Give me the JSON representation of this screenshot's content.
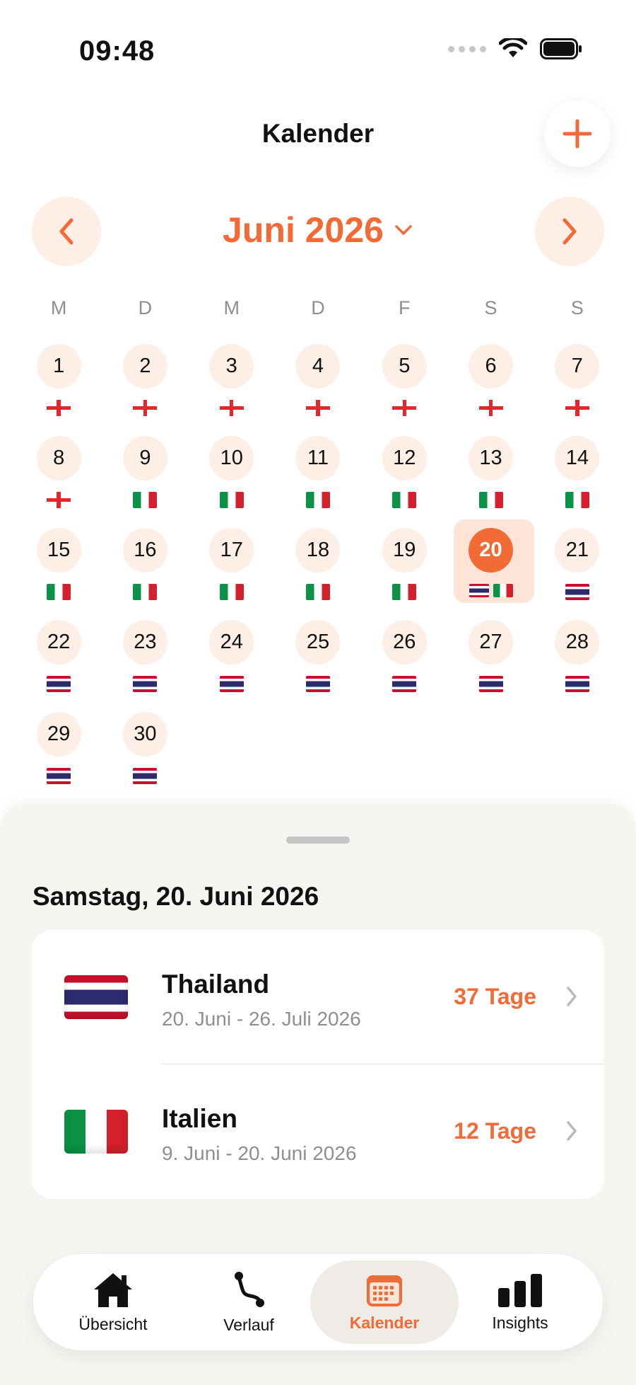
{
  "status_bar": {
    "time": "09:48"
  },
  "header": {
    "title": "Kalender",
    "add_icon": "plus-icon"
  },
  "month_nav": {
    "label": "Juni 2026",
    "prev_icon": "chevron-left-icon",
    "next_icon": "chevron-right-icon",
    "dropdown_icon": "chevron-down-icon"
  },
  "weekdays": [
    "M",
    "D",
    "M",
    "D",
    "F",
    "S",
    "S"
  ],
  "calendar": {
    "selected_day": "20",
    "days": [
      {
        "num": "1",
        "flags": [
          "georgia"
        ]
      },
      {
        "num": "2",
        "flags": [
          "georgia"
        ]
      },
      {
        "num": "3",
        "flags": [
          "georgia"
        ]
      },
      {
        "num": "4",
        "flags": [
          "georgia"
        ]
      },
      {
        "num": "5",
        "flags": [
          "georgia"
        ]
      },
      {
        "num": "6",
        "flags": [
          "georgia"
        ]
      },
      {
        "num": "7",
        "flags": [
          "georgia"
        ]
      },
      {
        "num": "8",
        "flags": [
          "georgia"
        ]
      },
      {
        "num": "9",
        "flags": [
          "italy"
        ]
      },
      {
        "num": "10",
        "flags": [
          "italy"
        ]
      },
      {
        "num": "11",
        "flags": [
          "italy"
        ]
      },
      {
        "num": "12",
        "flags": [
          "italy"
        ]
      },
      {
        "num": "13",
        "flags": [
          "italy"
        ]
      },
      {
        "num": "14",
        "flags": [
          "italy"
        ]
      },
      {
        "num": "15",
        "flags": [
          "italy"
        ]
      },
      {
        "num": "16",
        "flags": [
          "italy"
        ]
      },
      {
        "num": "17",
        "flags": [
          "italy"
        ]
      },
      {
        "num": "18",
        "flags": [
          "italy"
        ]
      },
      {
        "num": "19",
        "flags": [
          "italy"
        ]
      },
      {
        "num": "20",
        "flags": [
          "thailand",
          "italy"
        ]
      },
      {
        "num": "21",
        "flags": [
          "thailand"
        ]
      },
      {
        "num": "22",
        "flags": [
          "thailand"
        ]
      },
      {
        "num": "23",
        "flags": [
          "thailand"
        ]
      },
      {
        "num": "24",
        "flags": [
          "thailand"
        ]
      },
      {
        "num": "25",
        "flags": [
          "thailand"
        ]
      },
      {
        "num": "26",
        "flags": [
          "thailand"
        ]
      },
      {
        "num": "27",
        "flags": [
          "thailand"
        ]
      },
      {
        "num": "28",
        "flags": [
          "thailand"
        ]
      },
      {
        "num": "29",
        "flags": [
          "thailand"
        ]
      },
      {
        "num": "30",
        "flags": [
          "thailand"
        ]
      }
    ]
  },
  "sheet": {
    "date_title": "Samstag, 20. Juni 2026",
    "trips": [
      {
        "flag": "thailand",
        "country": "Thailand",
        "dates": "20. Juni - 26. Juli 2026",
        "duration": "37 Tage"
      },
      {
        "flag": "italy",
        "country": "Italien",
        "dates": "9. Juni - 20. Juni 2026",
        "duration": "12 Tage"
      }
    ]
  },
  "tab_bar": {
    "tabs": [
      {
        "label": "Übersicht",
        "icon": "house-icon"
      },
      {
        "label": "Verlauf",
        "icon": "route-icon"
      },
      {
        "label": "Kalender",
        "icon": "calendar-icon",
        "active": true
      },
      {
        "label": "Insights",
        "icon": "bar-chart-icon"
      }
    ]
  },
  "colors": {
    "accent": "#f26b37",
    "accent_soft": "#fdeee6",
    "sheet_bg": "#f7f5f2"
  }
}
